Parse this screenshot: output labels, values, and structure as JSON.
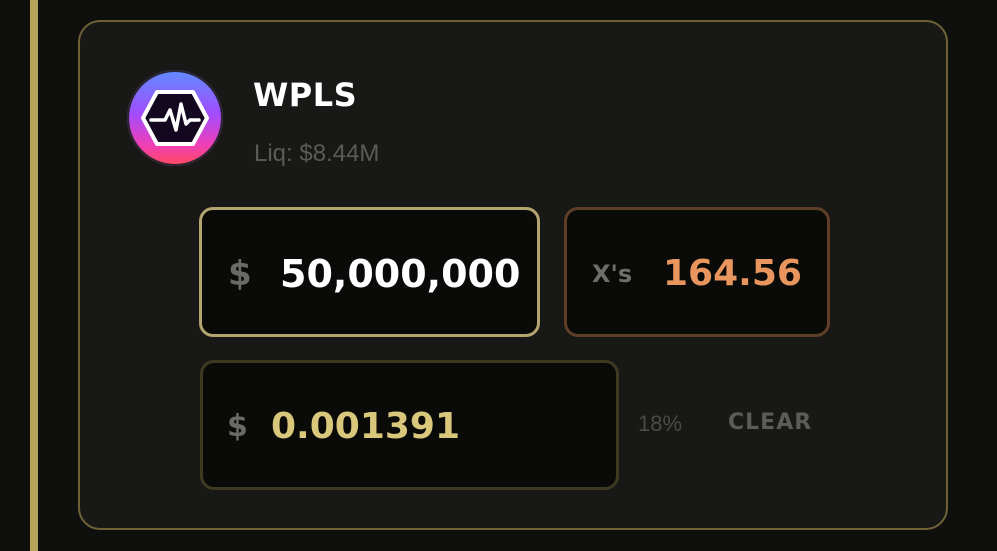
{
  "token": {
    "name": "WPLS",
    "liquidity": "Liq: $8.44M",
    "logo_icon": "pulse-hexagon-icon"
  },
  "amount": {
    "currency_symbol": "$",
    "value": "50,000,000"
  },
  "multiplier": {
    "label": "X's",
    "value": "164.56"
  },
  "price": {
    "currency_symbol": "$",
    "value": "0.001391"
  },
  "percent": "18%",
  "clear_label": "CLEAR",
  "colors": {
    "accent_gold": "#b3a56e",
    "multiplier_orange": "#e8965e",
    "price_gold": "#d9c77b"
  }
}
